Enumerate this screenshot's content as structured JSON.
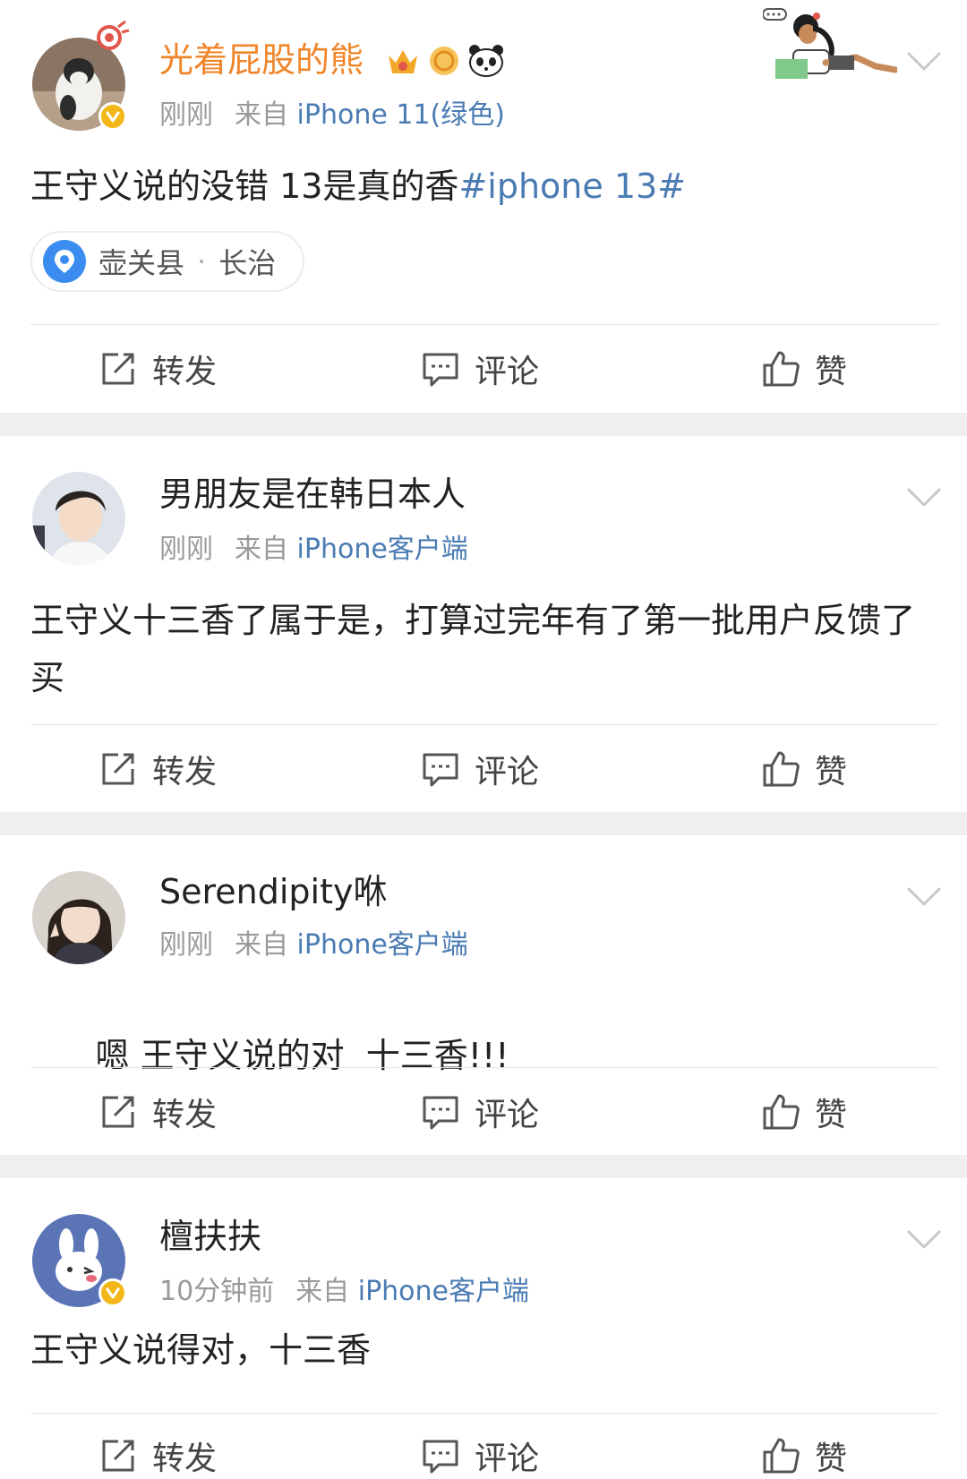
{
  "posts": [
    {
      "username": "光着屁股的熊",
      "verified": true,
      "time": "刚刚",
      "from_label": "来自",
      "source": "iPhone 11(绿色)",
      "content_text": "王守义说的没错 13是真的香",
      "hashtag": "#iphone 13#",
      "location": {
        "county": "壶关县",
        "separator": "·",
        "city": "长治"
      },
      "actions": {
        "repost": "转发",
        "comment": "评论",
        "like": "赞"
      }
    },
    {
      "username": "男朋友是在韩日本人",
      "verified": false,
      "time": "刚刚",
      "from_label": "来自",
      "source": "iPhone客户端",
      "content_text": "王守义十三香了属于是，打算过完年有了第一批用户反馈了买",
      "actions": {
        "repost": "转发",
        "comment": "评论",
        "like": "赞"
      }
    },
    {
      "username": "Serendipity咻",
      "verified": false,
      "time": "刚刚",
      "from_label": "来自",
      "source": "iPhone客户端",
      "content_text": "嗯 王守义说的对  十三香!!!",
      "actions": {
        "repost": "转发",
        "comment": "评论",
        "like": "赞"
      }
    },
    {
      "username": "檀扶扶",
      "verified": true,
      "time": "10分钟前",
      "from_label": "来自",
      "source": "iPhone客户端",
      "content_text": "王守义说得对，十三香",
      "actions": {
        "repost": "转发",
        "comment": "评论",
        "like": "赞"
      }
    }
  ],
  "icons": {
    "repost": "repost-icon",
    "comment": "comment-icon",
    "like": "thumbs-up-icon",
    "more": "chevron-down-icon",
    "location": "location-pin-icon",
    "verified": "verified-badge-icon"
  },
  "colors": {
    "link_blue": "#4a7bb3",
    "vip_name": "#f0852a",
    "meta_gray": "#9a9a9a",
    "verified_gold": "#f4b71a",
    "separator": "#efefef"
  }
}
